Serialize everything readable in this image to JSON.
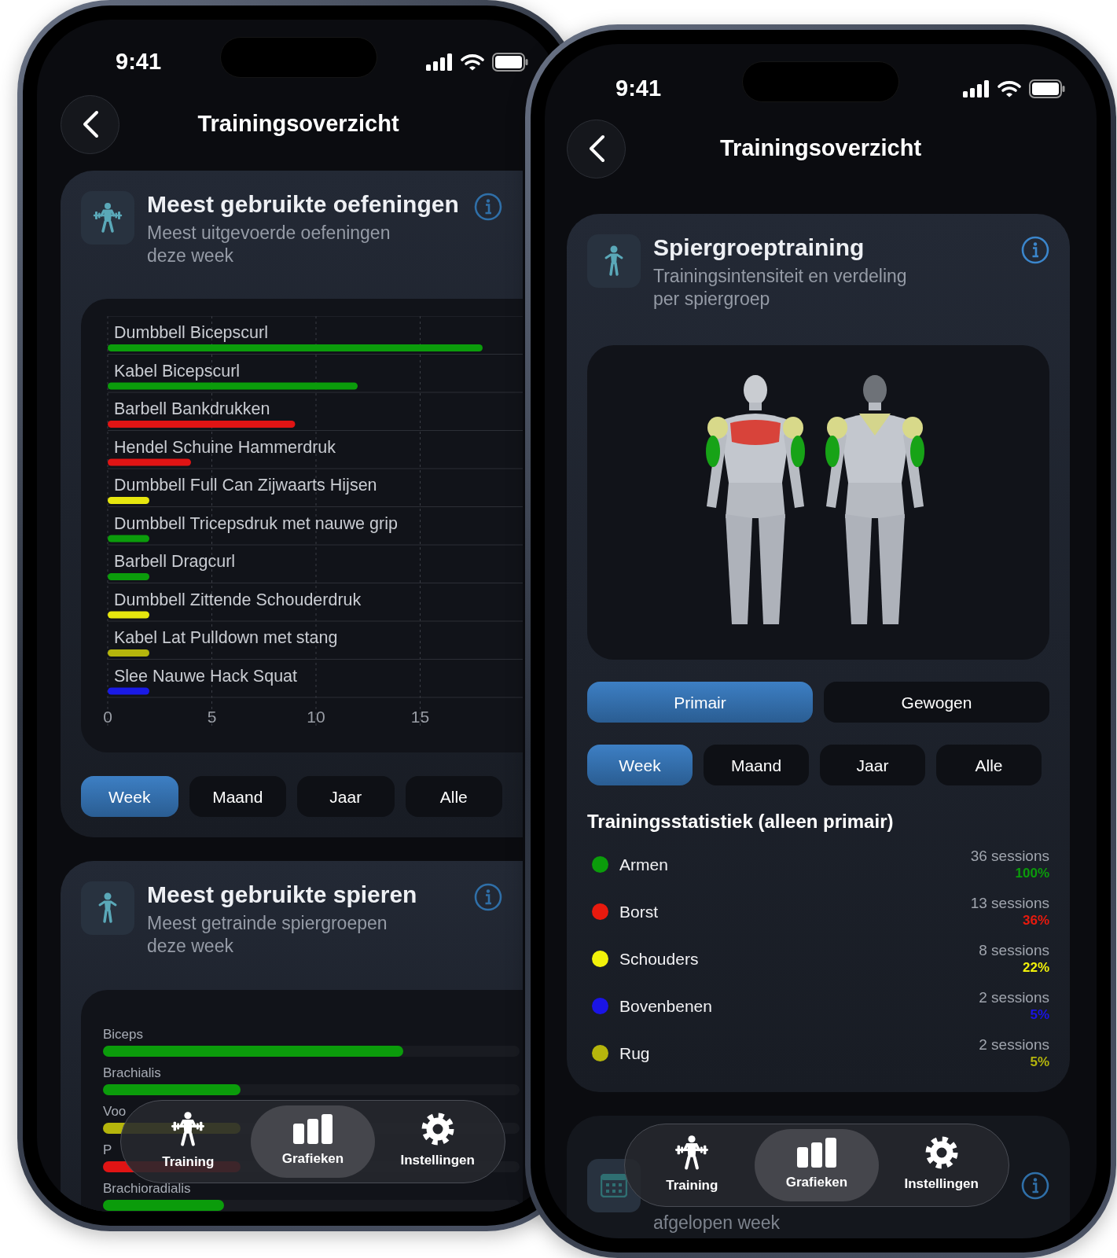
{
  "phones": [
    {
      "status_bar": {
        "time": "9:41"
      },
      "header": {
        "title": "Trainingsoverzicht"
      },
      "cards": [
        {
          "kind": "exercise_chart",
          "title": "Meest gebruikte oefeningen",
          "subtitle": "Meest uitgevoerde oefeningen deze week",
          "chart_data": {
            "type": "bar",
            "orientation": "horizontal",
            "categories": [
              "Dumbbell Bicepscurl",
              "Kabel Bicepscurl",
              "Barbell Bankdrukken",
              "Hendel Schuine Hammerdruk",
              "Dumbbell Full Can Zijwaarts Hijsen",
              "Dumbbell Tricepsdruk met nauwe grip",
              "Barbell Dragcurl",
              "Dumbbell Zittende Schouderdruk",
              "Kabel Lat Pulldown met stang",
              "Slee Nauwe Hack Squat"
            ],
            "series": [
              {
                "color": "#0b9c0b",
                "values": [
                  18,
                  12,
                  null,
                  null,
                  null,
                  2,
                  2,
                  null,
                  null,
                  null
                ]
              },
              {
                "color": "#e01414",
                "values": [
                  null,
                  null,
                  9,
                  4,
                  null,
                  null,
                  null,
                  null,
                  null,
                  null
                ]
              },
              {
                "color": "#e6e60e",
                "values": [
                  null,
                  null,
                  null,
                  null,
                  2,
                  null,
                  null,
                  2,
                  null,
                  null
                ]
              },
              {
                "color": "#b5b50c",
                "values": [
                  null,
                  null,
                  null,
                  null,
                  null,
                  null,
                  null,
                  null,
                  2,
                  null
                ]
              },
              {
                "color": "#1a1ae6",
                "values": [
                  null,
                  null,
                  null,
                  null,
                  null,
                  null,
                  null,
                  null,
                  null,
                  2
                ]
              }
            ],
            "grid": true,
            "xlim": [
              0,
              22
            ],
            "xticks": [
              0,
              5,
              10,
              15
            ]
          },
          "periods": [
            {
              "label": "Week",
              "selected": true
            },
            {
              "label": "Maand",
              "selected": false
            },
            {
              "label": "Jaar",
              "selected": false
            },
            {
              "label": "Alle",
              "selected": false
            }
          ]
        },
        {
          "kind": "muscle_bars",
          "title": "Meest gebruikte spieren",
          "subtitle": "Meest getrainde spiergroepen deze week",
          "bars": [
            {
              "label": "Biceps",
              "level": 0.72,
              "color": "#0b9c0b"
            },
            {
              "label": "Brachialis",
              "level": 0.33,
              "color": "#0b9c0b"
            },
            {
              "label": "Voo",
              "level": 0.33,
              "color": "#b5b50c"
            },
            {
              "label": "P",
              "level": 0.33,
              "color": "#e01414"
            },
            {
              "label": "Brachioradialis",
              "level": 0.29,
              "color": "#0b9c0b"
            }
          ]
        }
      ],
      "tab_bar": [
        {
          "label": "Training",
          "selected": false
        },
        {
          "label": "Grafieken",
          "selected": true
        },
        {
          "label": "Instellingen",
          "selected": false
        }
      ]
    },
    {
      "status_bar": {
        "time": "9:41"
      },
      "header": {
        "title": "Trainingsoverzicht"
      },
      "cards": [
        {
          "kind": "body_map",
          "title": "Spiergroeptraining",
          "subtitle": "Trainingsintensiteit en verdeling per spiergroep",
          "modes": [
            {
              "label": "Primair",
              "selected": true
            },
            {
              "label": "Gewogen",
              "selected": false
            }
          ],
          "periods": [
            {
              "label": "Week",
              "selected": true
            },
            {
              "label": "Maand",
              "selected": false
            },
            {
              "label": "Jaar",
              "selected": false
            },
            {
              "label": "Alle",
              "selected": false
            }
          ],
          "stats_title": "Trainingsstatistiek (alleen primair)",
          "stats": [
            {
              "name": "Armen",
              "color": "#0b9c0b",
              "sessions": "36 sessions",
              "percent": "100%"
            },
            {
              "name": "Borst",
              "color": "#e81a0e",
              "sessions": "13 sessions",
              "percent": "36%"
            },
            {
              "name": "Schouders",
              "color": "#f2f20a",
              "sessions": "8 sessions",
              "percent": "22%"
            },
            {
              "name": "Bovenbenen",
              "color": "#1a14e6",
              "sessions": "2 sessions",
              "percent": "5%"
            },
            {
              "name": "Rug",
              "color": "#b5b50c",
              "sessions": "2 sessions",
              "percent": "5%"
            }
          ]
        },
        {
          "kind": "partial",
          "subtitle": "afgelopen week"
        }
      ],
      "tab_bar": [
        {
          "label": "Training",
          "selected": false
        },
        {
          "label": "Grafieken",
          "selected": true
        },
        {
          "label": "Instellingen",
          "selected": false
        }
      ]
    }
  ]
}
